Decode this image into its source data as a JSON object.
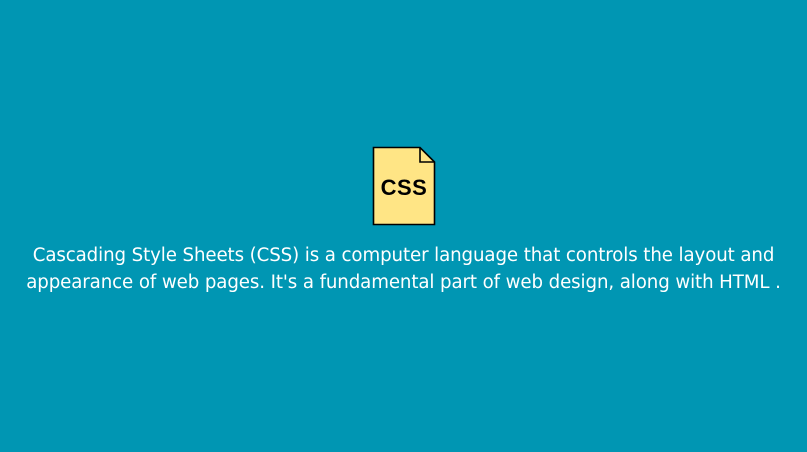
{
  "icon": {
    "name": "css-file-icon",
    "label": "CSS",
    "fill_color": "#ffe585",
    "stroke_color": "#000000"
  },
  "description": {
    "text": "Cascading Style Sheets (CSS) is a computer language that controls the layout and appearance of web pages. It's a fundamental part of web design, along with HTML ."
  },
  "colors": {
    "background": "#0096b3",
    "text": "#ffffff"
  }
}
